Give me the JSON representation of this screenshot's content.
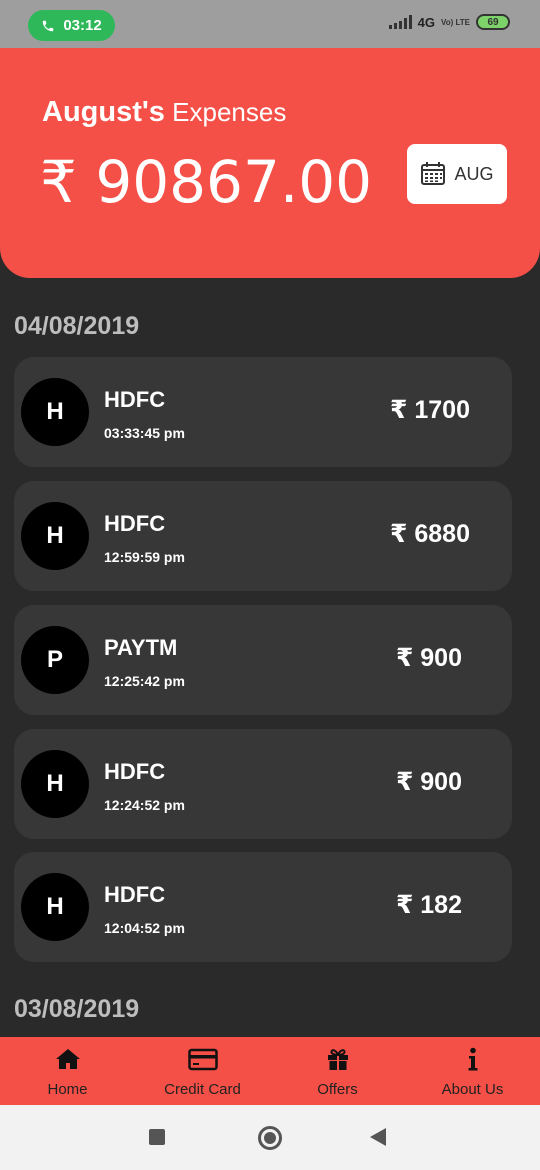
{
  "status_bar": {
    "call_time": "03:12",
    "network": "4G",
    "network_sub": "Vo) LTE",
    "battery": "69"
  },
  "header": {
    "month_name": "August's",
    "label": "Expenses",
    "total": "₹ 90867.00",
    "month_button": "AUG"
  },
  "groups": [
    {
      "date": "04/08/2019",
      "transactions": [
        {
          "initial": "H",
          "merchant": "HDFC",
          "time": "03:33:45 pm",
          "amount": "₹ 1700"
        },
        {
          "initial": "H",
          "merchant": "HDFC",
          "time": "12:59:59 pm",
          "amount": "₹ 6880"
        },
        {
          "initial": "P",
          "merchant": "PAYTM",
          "time": "12:25:42 pm",
          "amount": "₹ 900"
        },
        {
          "initial": "H",
          "merchant": "HDFC",
          "time": "12:24:52 pm",
          "amount": "₹ 900"
        },
        {
          "initial": "H",
          "merchant": "HDFC",
          "time": "12:04:52 pm",
          "amount": "₹ 182"
        }
      ]
    },
    {
      "date": "03/08/2019",
      "transactions": []
    }
  ],
  "bottom_nav": [
    {
      "label": "Home",
      "icon": "home-icon"
    },
    {
      "label": "Credit Card",
      "icon": "credit-card-icon"
    },
    {
      "label": "Offers",
      "icon": "gift-icon"
    },
    {
      "label": "About Us",
      "icon": "info-icon"
    }
  ],
  "colors": {
    "accent": "#f55047",
    "background": "#2a2a2a",
    "card": "#373737",
    "call_pill": "#2fb85a"
  }
}
